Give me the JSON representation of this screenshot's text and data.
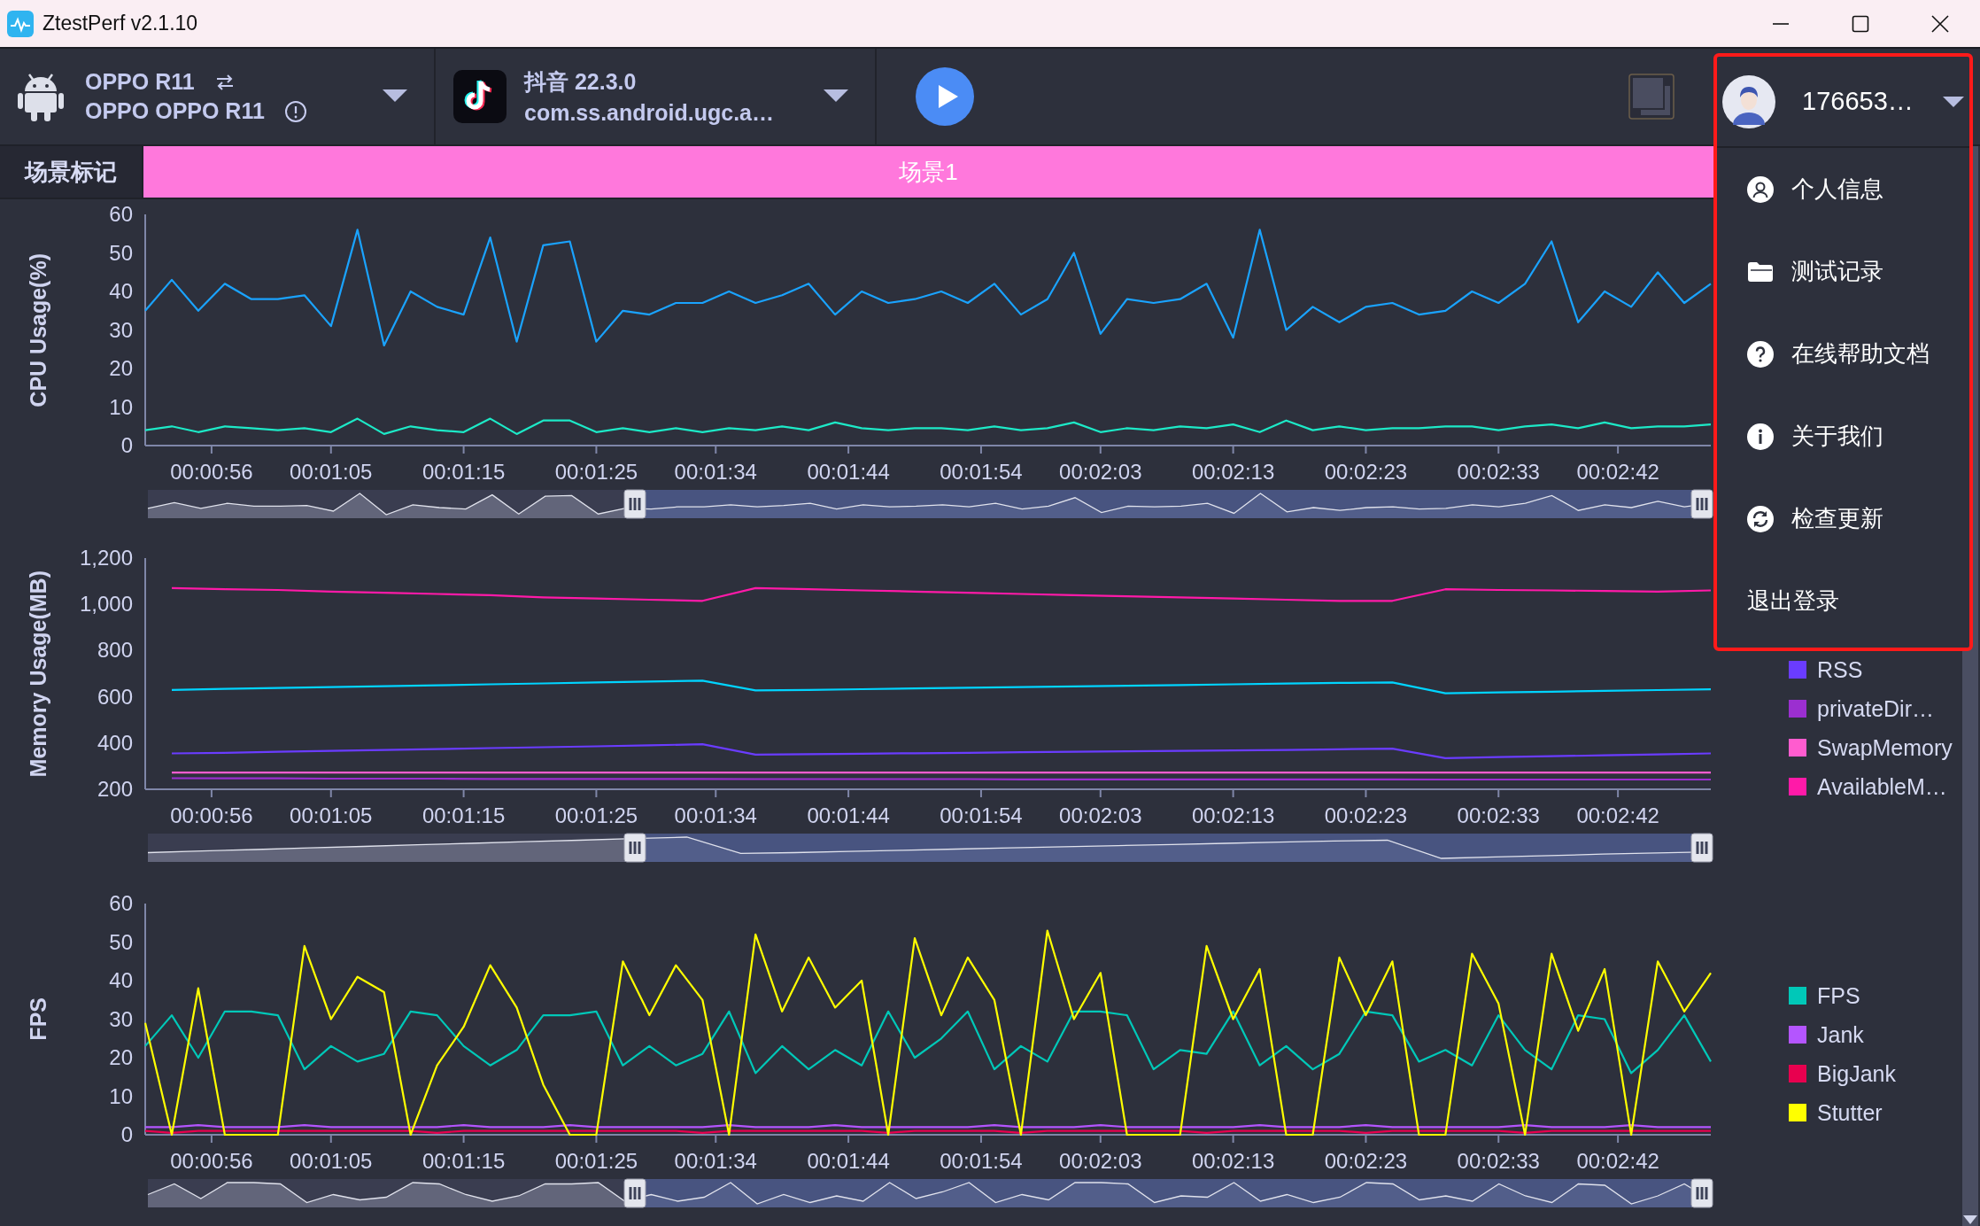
{
  "window": {
    "title": "ZtestPerf v2.1.10"
  },
  "toolbar": {
    "device": {
      "name": "OPPO R11",
      "model": "OPPO OPPO R11"
    },
    "app": {
      "name": "抖音 22.3.0",
      "package": "com.ss.android.ugc.a…"
    },
    "user": {
      "name": "176653…"
    }
  },
  "scene_bar": {
    "label": "场景标记",
    "scenes": [
      {
        "label": "场景1"
      }
    ]
  },
  "user_menu": {
    "items": [
      {
        "label": "个人信息",
        "kind": "profile"
      },
      {
        "label": "测试记录",
        "kind": "records"
      },
      {
        "label": "在线帮助文档",
        "kind": "help"
      },
      {
        "label": "关于我们",
        "kind": "about"
      },
      {
        "label": "检查更新",
        "kind": "update"
      },
      {
        "label": "退出登录",
        "kind": "logout"
      }
    ]
  },
  "charts": [
    {
      "chart_data": {
        "type": "line",
        "ylabel": "CPU Usage(%)",
        "xlim": [
          51,
          169
        ],
        "ylim": [
          0,
          60
        ],
        "yticks": [
          0,
          10,
          20,
          30,
          40,
          50,
          60
        ],
        "xticks": [
          {
            "value": 56,
            "label": "00:00:56"
          },
          {
            "value": 65,
            "label": "00:01:05"
          },
          {
            "value": 75,
            "label": "00:01:15"
          },
          {
            "value": 85,
            "label": "00:01:25"
          },
          {
            "value": 94,
            "label": "00:01:34"
          },
          {
            "value": 104,
            "label": "00:01:44"
          },
          {
            "value": 114,
            "label": "00:01:54"
          },
          {
            "value": 123,
            "label": "00:02:03"
          },
          {
            "value": 133,
            "label": "00:02:13"
          },
          {
            "value": 143,
            "label": "00:02:23"
          },
          {
            "value": 153,
            "label": "00:02:33"
          },
          {
            "value": 162,
            "label": "00:02:42"
          }
        ],
        "x": [
          51,
          53,
          55,
          57,
          59,
          61,
          63,
          65,
          67,
          69,
          71,
          73,
          75,
          77,
          79,
          81,
          83,
          85,
          87,
          89,
          91,
          93,
          95,
          97,
          99,
          101,
          103,
          105,
          107,
          109,
          111,
          113,
          115,
          117,
          119,
          121,
          123,
          125,
          127,
          129,
          131,
          133,
          135,
          137,
          139,
          141,
          143,
          145,
          147,
          149,
          151,
          153,
          155,
          157,
          159,
          161,
          163,
          165,
          167,
          169
        ],
        "series": [
          {
            "color": "#1aa3ff",
            "values": [
              35,
              43,
              35,
              42,
              38,
              38,
              39,
              31,
              56,
              26,
              40,
              36,
              34,
              54,
              27,
              52,
              53,
              27,
              35,
              34,
              37,
              37,
              40,
              37,
              39,
              42,
              34,
              40,
              37,
              38,
              40,
              37,
              42,
              34,
              38,
              50,
              29,
              38,
              37,
              38,
              42,
              28,
              56,
              30,
              36,
              32,
              36,
              37,
              34,
              35,
              40,
              37,
              42,
              53,
              32,
              40,
              36,
              45,
              37,
              42
            ]
          },
          {
            "color": "#1de9c7",
            "values": [
              4,
              5,
              3.5,
              5,
              4.5,
              4,
              4.5,
              3.5,
              7,
              3,
              5,
              4,
              3.5,
              7,
              3,
              6.5,
              6.5,
              3.5,
              4.5,
              3.5,
              4.5,
              3.5,
              4.5,
              4,
              5,
              4,
              6,
              4.5,
              4,
              4.5,
              4.5,
              4,
              5,
              4,
              4.5,
              6,
              3.5,
              4.5,
              4,
              5,
              4.5,
              5.5,
              3.5,
              6.5,
              4,
              5,
              4,
              4.5,
              4.5,
              5,
              5,
              4,
              5,
              5.5,
              4.5,
              6,
              4.5,
              5,
              5,
              5.5
            ]
          }
        ]
      }
    },
    {
      "chart_data": {
        "type": "line",
        "ylabel": "Memory Usage(MB)",
        "xlim": [
          51,
          169
        ],
        "ylim": [
          200,
          1200
        ],
        "yticks": [
          200,
          400,
          600,
          800,
          {
            "value": 1000,
            "label": "1,000"
          },
          {
            "value": 1200,
            "label": "1,200"
          }
        ],
        "xticks": [
          {
            "value": 56,
            "label": "00:00:56"
          },
          {
            "value": 65,
            "label": "00:01:05"
          },
          {
            "value": 75,
            "label": "00:01:15"
          },
          {
            "value": 85,
            "label": "00:01:25"
          },
          {
            "value": 94,
            "label": "00:01:34"
          },
          {
            "value": 104,
            "label": "00:01:44"
          },
          {
            "value": 114,
            "label": "00:01:54"
          },
          {
            "value": 123,
            "label": "00:02:03"
          },
          {
            "value": 133,
            "label": "00:02:13"
          },
          {
            "value": 143,
            "label": "00:02:23"
          },
          {
            "value": 153,
            "label": "00:02:33"
          },
          {
            "value": 162,
            "label": "00:02:42"
          }
        ],
        "x": [
          53,
          57,
          61,
          65,
          69,
          73,
          77,
          81,
          85,
          89,
          93,
          97,
          101,
          105,
          109,
          113,
          117,
          121,
          125,
          129,
          133,
          137,
          141,
          145,
          149,
          153,
          157,
          161,
          165,
          169
        ],
        "series": [
          {
            "color": "#00d4ff",
            "values": [
              630,
              634,
              638,
              642,
              646,
              650,
              654,
              658,
              662,
              666,
              670,
              628,
              630,
              633,
              636,
              639,
              642,
              645,
              648,
              651,
              654,
              657,
              660,
              662,
              615,
              619,
              622,
              626,
              629,
              632
            ]
          },
          {
            "name": "RSS",
            "color": "#6a3cff",
            "values": [
              355,
              358,
              362,
              366,
              370,
              374,
              378,
              382,
              386,
              390,
              395,
              350,
              352,
              354,
              356,
              358,
              360,
              362,
              364,
              366,
              368,
              370,
              373,
              376,
              335,
              339,
              343,
              347,
              351,
              355
            ]
          },
          {
            "name": "privateDir…",
            "color": "#9b2fd0",
            "values": [
              248,
              247,
              247,
              246,
              246,
              246,
              245,
              245,
              245,
              245,
              245,
              244,
              244,
              244,
              244,
              244,
              243,
              243,
              243,
              243,
              243,
              243,
              243,
              243,
              242,
              242,
              242,
              242,
              242,
              242
            ]
          },
          {
            "name": "SwapMemory",
            "color": "#ff5ccf",
            "values": [
              272,
              272,
              272,
              272,
              272,
              272,
              272,
              272,
              272,
              272,
              272,
              272,
              272,
              272,
              272,
              272,
              272,
              272,
              272,
              272,
              272,
              272,
              272,
              272,
              272,
              272,
              272,
              272,
              272,
              272
            ]
          },
          {
            "name": "AvailableM…",
            "color": "#ff1aa8",
            "values": [
              1070,
              1065,
              1062,
              1055,
              1050,
              1045,
              1040,
              1030,
              1025,
              1020,
              1015,
              1070,
              1065,
              1060,
              1055,
              1050,
              1045,
              1040,
              1035,
              1030,
              1025,
              1020,
              1015,
              1015,
              1065,
              1062,
              1060,
              1058,
              1055,
              1060
            ]
          }
        ]
      }
    },
    {
      "chart_data": {
        "type": "line",
        "ylabel": "FPS",
        "xlim": [
          51,
          169
        ],
        "ylim": [
          0,
          60
        ],
        "yticks": [
          0,
          10,
          20,
          30,
          40,
          50,
          60
        ],
        "xticks": [
          {
            "value": 56,
            "label": "00:00:56"
          },
          {
            "value": 65,
            "label": "00:01:05"
          },
          {
            "value": 75,
            "label": "00:01:15"
          },
          {
            "value": 85,
            "label": "00:01:25"
          },
          {
            "value": 94,
            "label": "00:01:34"
          },
          {
            "value": 104,
            "label": "00:01:44"
          },
          {
            "value": 114,
            "label": "00:01:54"
          },
          {
            "value": 123,
            "label": "00:02:03"
          },
          {
            "value": 133,
            "label": "00:02:13"
          },
          {
            "value": 143,
            "label": "00:02:23"
          },
          {
            "value": 153,
            "label": "00:02:33"
          },
          {
            "value": 162,
            "label": "00:02:42"
          }
        ],
        "x": [
          51,
          53,
          55,
          57,
          59,
          61,
          63,
          65,
          67,
          69,
          71,
          73,
          75,
          77,
          79,
          81,
          83,
          85,
          87,
          89,
          91,
          93,
          95,
          97,
          99,
          101,
          103,
          105,
          107,
          109,
          111,
          113,
          115,
          117,
          119,
          121,
          123,
          125,
          127,
          129,
          131,
          133,
          135,
          137,
          139,
          141,
          143,
          145,
          147,
          149,
          151,
          153,
          155,
          157,
          159,
          161,
          163,
          165,
          167,
          169
        ],
        "series": [
          {
            "name": "FPS",
            "color": "#00c8b8",
            "values": [
              23,
              31,
              20,
              32,
              32,
              31,
              17,
              23,
              19,
              21,
              32,
              31,
              23,
              18,
              22,
              31,
              31,
              32,
              18,
              23,
              18,
              21,
              32,
              16,
              23,
              17,
              22,
              18,
              32,
              20,
              25,
              32,
              17,
              23,
              19,
              32,
              32,
              31,
              17,
              22,
              21,
              32,
              18,
              23,
              17,
              21,
              32,
              31,
              19,
              22,
              18,
              31,
              22,
              17,
              31,
              30,
              16,
              22,
              31,
              19
            ]
          },
          {
            "name": "Jank",
            "color": "#b455ff",
            "values": [
              2,
              2,
              2.5,
              2,
              2,
              2,
              2.5,
              2,
              2,
              2,
              2,
              2,
              2.5,
              2,
              2,
              2,
              2.5,
              2,
              2,
              2,
              2,
              2,
              2.5,
              2,
              2,
              2,
              2.5,
              2,
              2,
              2,
              2,
              2,
              2.5,
              2,
              2,
              2,
              2.5,
              2,
              2,
              2,
              2,
              2,
              2.5,
              2,
              2,
              2,
              2.5,
              2,
              2,
              2,
              2,
              2,
              2.5,
              2,
              2,
              2,
              2.5,
              2,
              2,
              2
            ]
          },
          {
            "name": "BigJank",
            "color": "#e8004f",
            "values": [
              1,
              0.5,
              1,
              1,
              1,
              1,
              1,
              1,
              1,
              1,
              1,
              0.5,
              1,
              1,
              1,
              1,
              1,
              1,
              1,
              1,
              1,
              0.5,
              1,
              1,
              1,
              1,
              1,
              1,
              0.5,
              1,
              1,
              1,
              1,
              0.5,
              1,
              1,
              1,
              1,
              1,
              1,
              0.5,
              1,
              1,
              1,
              1,
              1,
              0.5,
              1,
              1,
              1,
              1,
              1,
              0.5,
              1,
              1,
              1,
              1,
              1,
              1,
              1
            ]
          },
          {
            "name": "Stutter",
            "color": "#ffff00",
            "values": [
              29,
              0,
              38,
              0,
              0,
              0,
              49,
              30,
              41,
              37,
              0,
              18,
              28,
              44,
              33,
              13,
              0,
              0,
              45,
              31,
              44,
              35,
              0,
              52,
              32,
              46,
              33,
              40,
              0,
              51,
              31,
              46,
              35,
              0,
              53,
              30,
              42,
              0,
              0,
              0,
              49,
              30,
              43,
              0,
              0,
              46,
              31,
              45,
              0,
              0,
              47,
              34,
              0,
              47,
              27,
              43,
              0,
              45,
              32,
              42
            ]
          }
        ]
      }
    }
  ]
}
